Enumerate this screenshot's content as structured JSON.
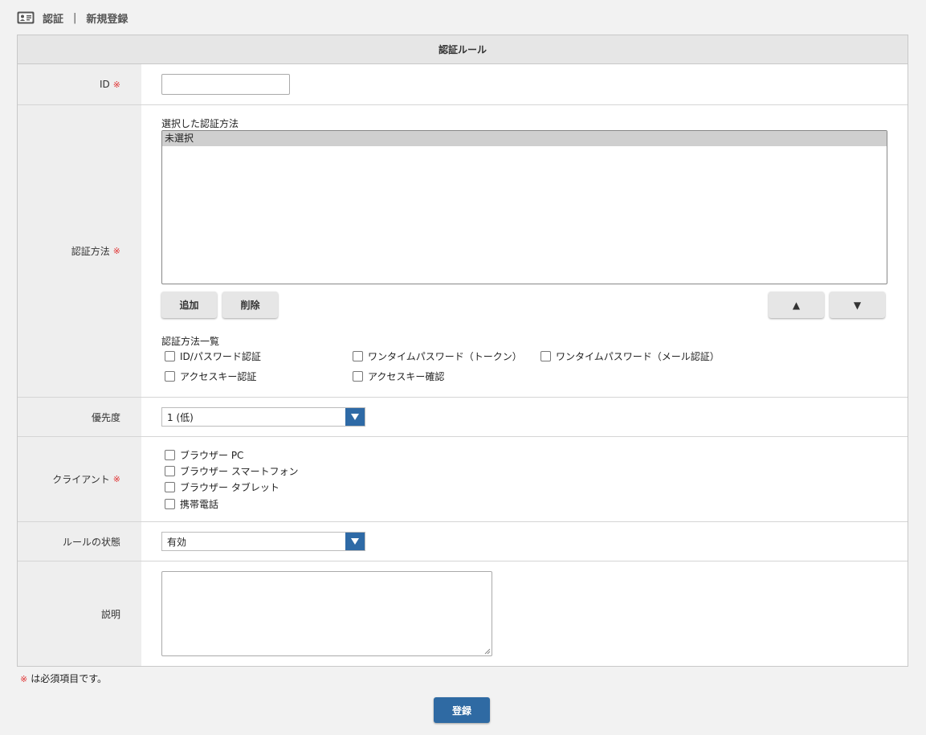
{
  "breadcrumb": {
    "section": "認証",
    "separator": "|",
    "page": "新規登録"
  },
  "table": {
    "header": "認証ルール"
  },
  "required_mark": "※",
  "id_field": {
    "label": "ID",
    "value": ""
  },
  "auth_method": {
    "label": "認証方法",
    "selected_title": "選択した認証方法",
    "selected_items": [
      "未選択"
    ],
    "add_button": "追加",
    "delete_button": "削除",
    "up_button": "▲",
    "down_button": "▼",
    "list_title": "認証方法一覧",
    "options": [
      "ID/パスワード認証",
      "ワンタイムパスワード（トークン）",
      "ワンタイムパスワード（メール認証）",
      "アクセスキー認証",
      "アクセスキー確認"
    ]
  },
  "priority": {
    "label": "優先度",
    "value": "1 (低)"
  },
  "client": {
    "label": "クライアント",
    "options": [
      "ブラウザー PC",
      "ブラウザー スマートフォン",
      "ブラウザー タブレット",
      "携帯電話"
    ]
  },
  "rule_status": {
    "label": "ルールの状態",
    "value": "有効"
  },
  "description": {
    "label": "説明",
    "value": ""
  },
  "footnote": "は必須項目です。",
  "submit_button": "登録",
  "colors": {
    "accent": "#2f6aa3",
    "required": "#e03030",
    "label_bg": "#eeeeee"
  }
}
